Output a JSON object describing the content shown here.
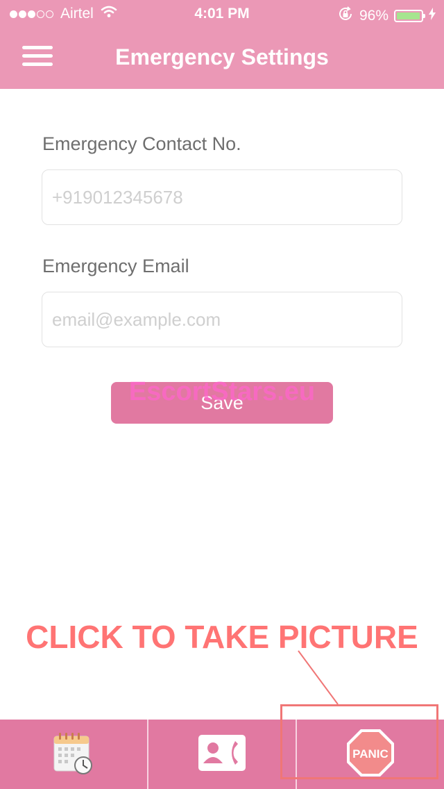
{
  "status_bar": {
    "carrier": "Airtel",
    "time": "4:01 PM",
    "battery": "96%",
    "signal_dots_filled": 3,
    "signal_dots_total": 5
  },
  "header": {
    "title": "Emergency Settings",
    "menu_icon": "hamburger-menu-icon"
  },
  "form": {
    "contact_label": "Emergency Contact No.",
    "contact_placeholder": "+919012345678",
    "contact_value": "",
    "email_label": "Emergency Email",
    "email_placeholder": "email@example.com",
    "email_value": "",
    "save_label": "Save"
  },
  "watermark": "EscortStars.eu",
  "annotation": "CLICK TO TAKE PICTURE",
  "tabs": [
    {
      "icon": "calendar-clock-icon"
    },
    {
      "icon": "contact-card-phone-icon"
    },
    {
      "icon": "panic-stop-sign-icon",
      "label": "PANIC"
    }
  ],
  "colors": {
    "header_pink": "#eb98b6",
    "tabbar_pink": "#e179a1",
    "annotation_red": "#ff7474"
  }
}
